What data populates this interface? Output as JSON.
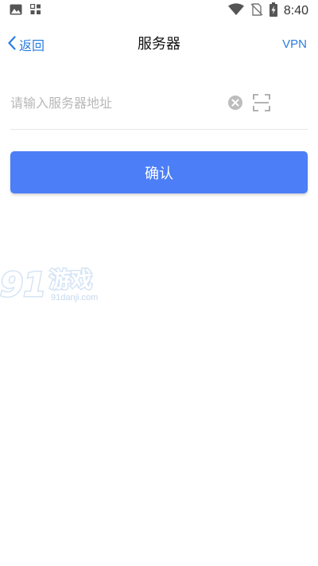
{
  "status_bar": {
    "time": "8:40",
    "icons": [
      "image-icon",
      "app-grid-icon",
      "wifi-icon",
      "no-sim-icon",
      "battery-charging-icon"
    ]
  },
  "nav": {
    "back_label": "返回",
    "title": "服务器",
    "vpn_label": "VPN"
  },
  "form": {
    "server_input": {
      "value": "",
      "placeholder": "请输入服务器地址"
    },
    "clear_icon": "clear-icon",
    "scan_icon": "scan-icon",
    "confirm_label": "确认"
  },
  "watermark": {
    "logo_number": "91",
    "logo_text": "游戏",
    "domain": "91danji.com"
  },
  "colors": {
    "accent": "#2a7de0",
    "primary_button": "#4c7ef7",
    "placeholder": "#b8b8b8",
    "divider": "#e6e6e6"
  }
}
